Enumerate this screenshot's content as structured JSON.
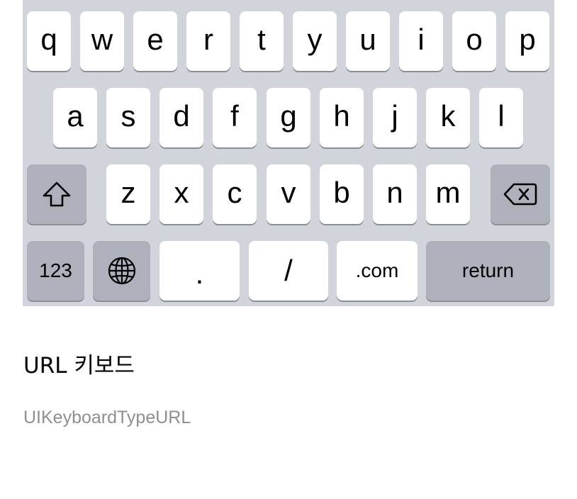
{
  "keyboard": {
    "row1": [
      "q",
      "w",
      "e",
      "r",
      "t",
      "y",
      "u",
      "i",
      "o",
      "p"
    ],
    "row2": [
      "a",
      "s",
      "d",
      "f",
      "g",
      "h",
      "j",
      "k",
      "l"
    ],
    "row3": [
      "z",
      "x",
      "c",
      "v",
      "b",
      "n",
      "m"
    ],
    "numbers_label": "123",
    "period_label": ".",
    "slash_label": "/",
    "dotcom_label": ".com",
    "return_label": "return",
    "colors": {
      "background": "#d1d4db",
      "key": "#ffffff",
      "modifier_key": "#acb1bc"
    },
    "icons": {
      "shift": "shift-arrow-icon",
      "delete": "backspace-icon",
      "globe": "globe-icon"
    }
  },
  "caption": {
    "title": "URL 키보드",
    "subtitle": "UIKeyboardTypeURL"
  }
}
